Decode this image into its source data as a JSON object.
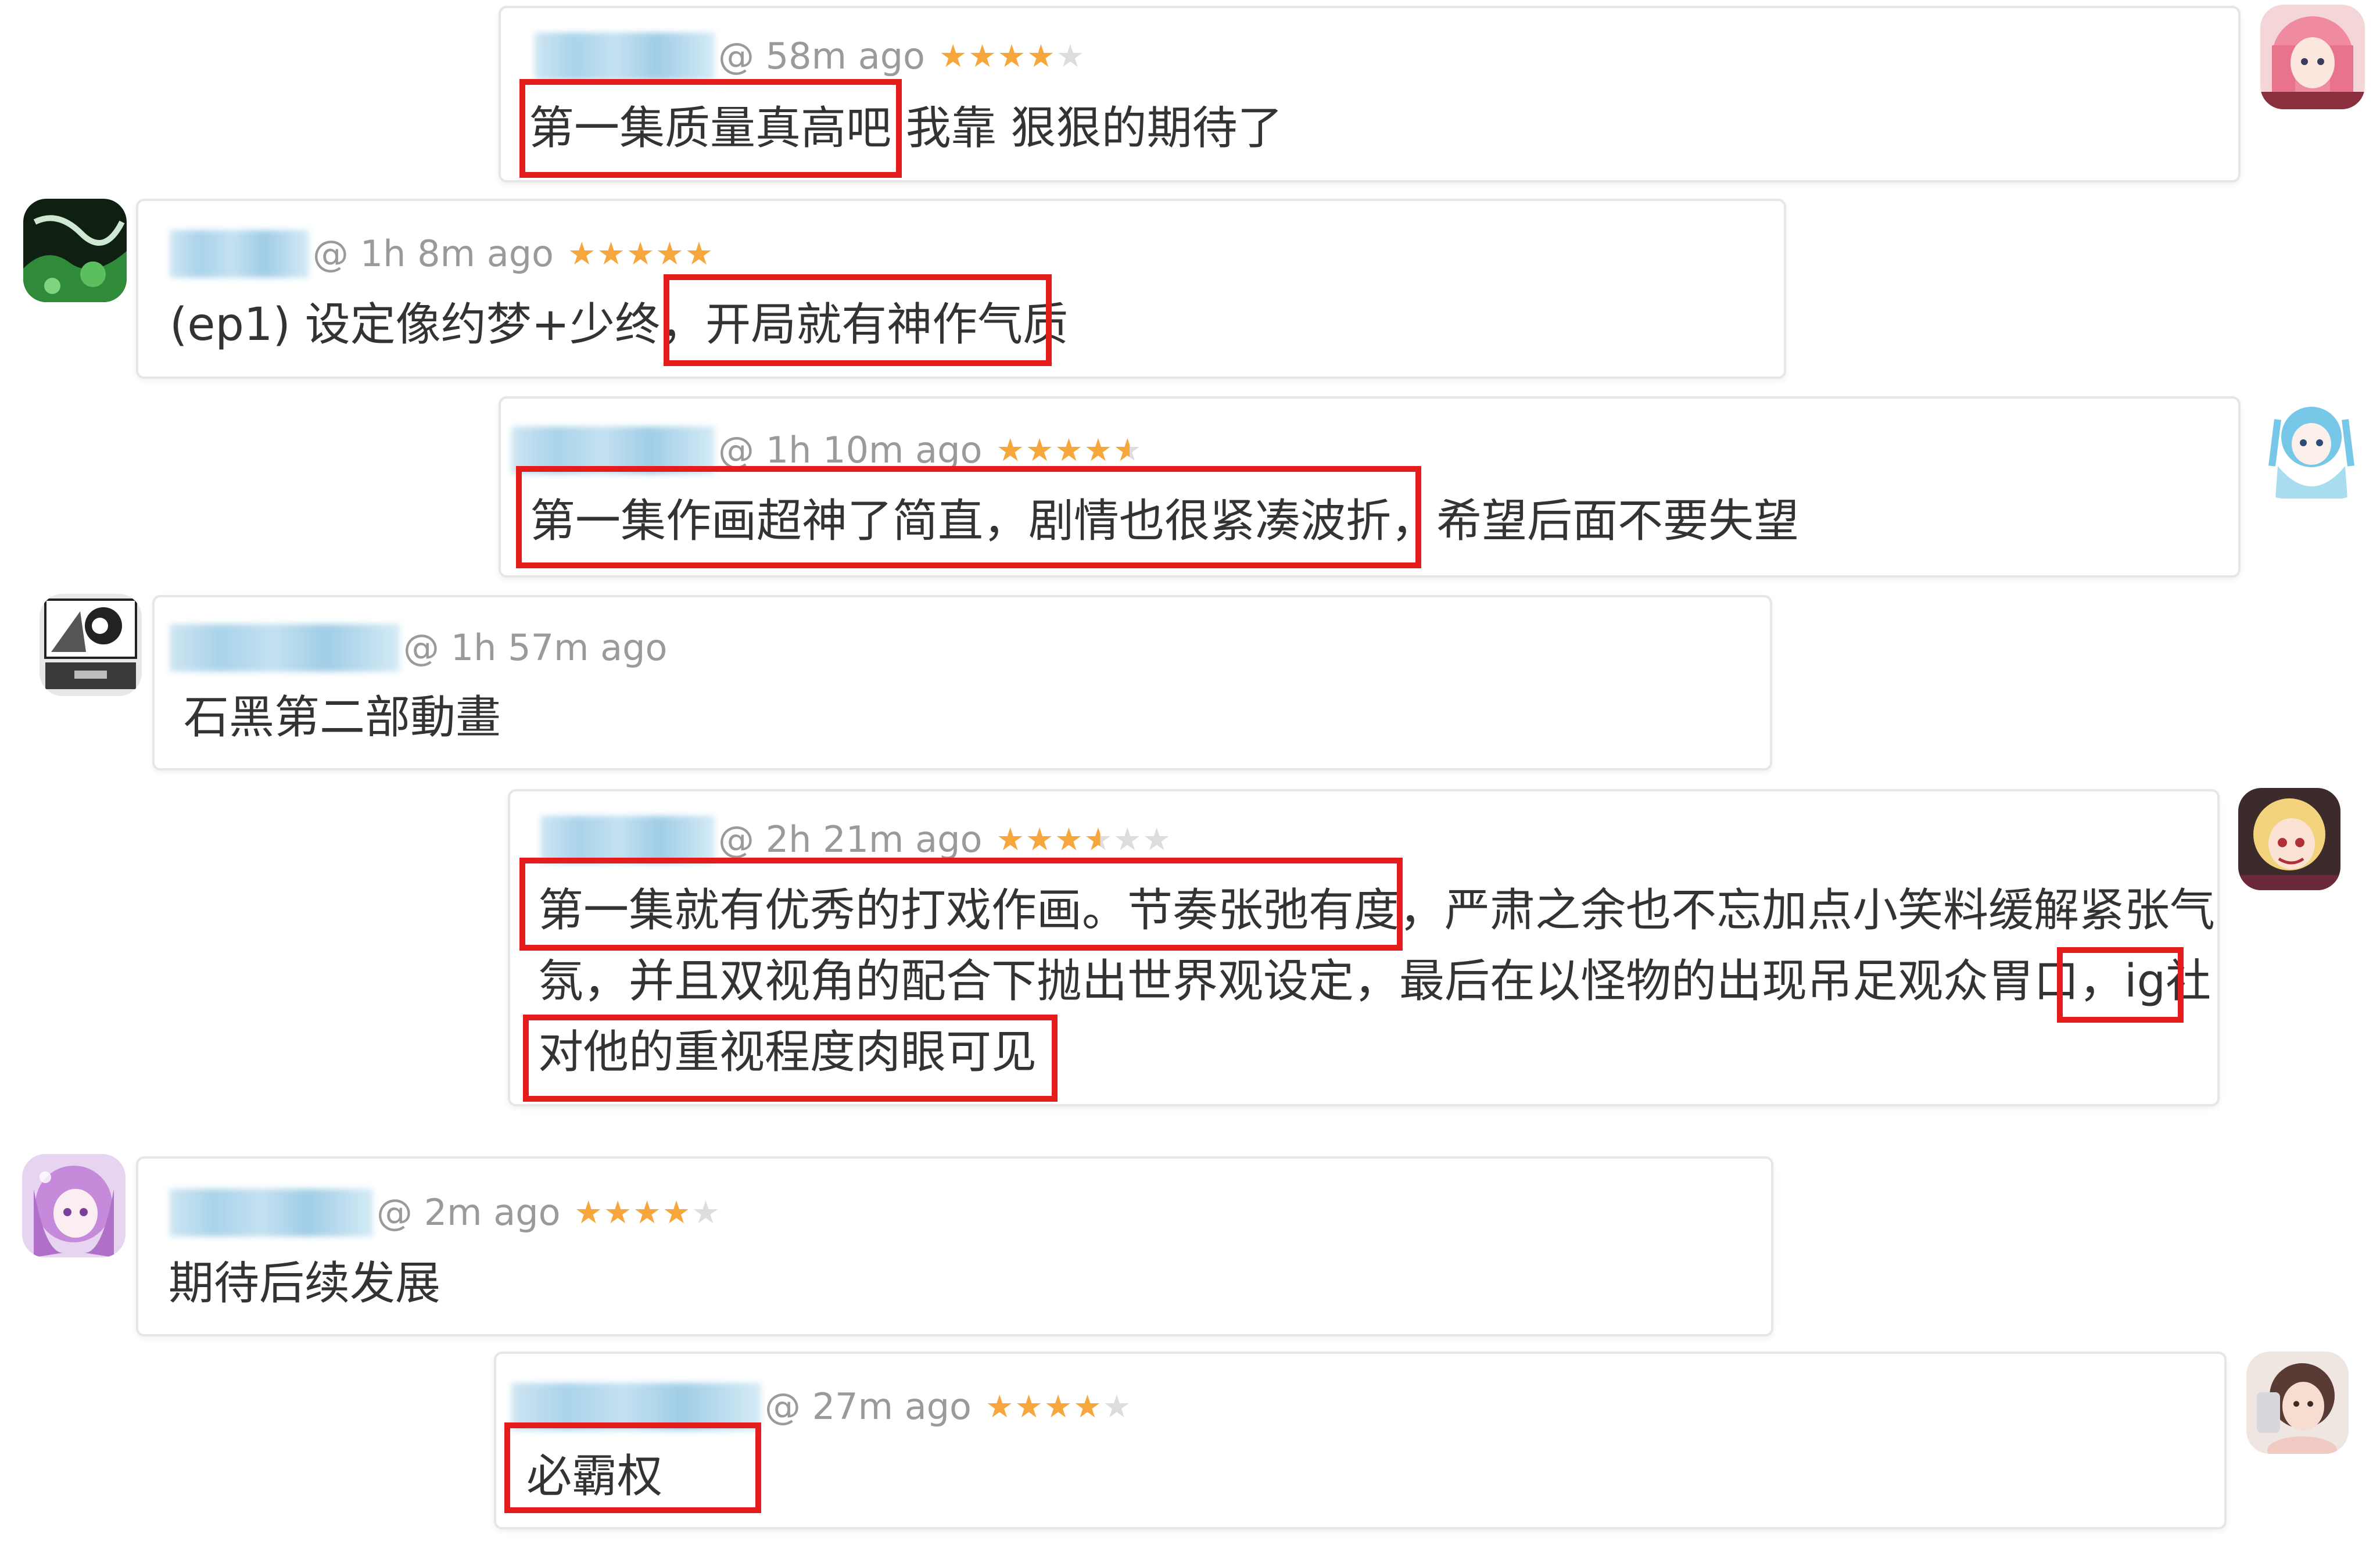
{
  "comments": [
    {
      "time": "@ 58m ago",
      "stars": [
        "on",
        "on",
        "on",
        "on",
        "off"
      ],
      "text": "第一集质量真高吧 我靠 狠狠的期待了",
      "avatar_icon": "pink-hair-girl-avatar"
    },
    {
      "time": "@ 1h 8m ago",
      "stars": [
        "on",
        "on",
        "on",
        "on",
        "on"
      ],
      "text": "(ep1) 设定像约梦+少终，开局就有神作气质",
      "avatar_icon": "dark-green-artwork-avatar"
    },
    {
      "time": "@ 1h 10m ago",
      "stars": [
        "on",
        "on",
        "on",
        "on",
        "half"
      ],
      "text": "第一集作画超神了简直，剧情也很紧凑波折，希望后面不要失望",
      "avatar_icon": "blue-hair-girl-avatar"
    },
    {
      "time": "@ 1h 57m ago",
      "stars": [],
      "text": "石黑第二部動畫",
      "avatar_icon": "manga-panel-avatar"
    },
    {
      "time": "@ 2h 21m ago",
      "stars": [
        "on",
        "on",
        "on",
        "half",
        "off",
        "off"
      ],
      "text": "第一集就有优秀的打戏作画。节奏张弛有度，严肃之余也不忘加点小笑料缓解紧张气\n氛，并且双视角的配合下抛出世界观设定，最后在以怪物的出现吊足观众胃口，ig社\n对他的重视程度肉眼可见",
      "avatar_icon": "blonde-girl-avatar"
    },
    {
      "time": "@ 2m ago",
      "stars": [
        "on",
        "on",
        "on",
        "on",
        "off"
      ],
      "text": "期待后续发展",
      "avatar_icon": "purple-hair-girl-avatar"
    },
    {
      "time": "@ 27m ago",
      "stars": [
        "on",
        "on",
        "on",
        "on",
        "off"
      ],
      "text": "必霸权",
      "avatar_icon": "selfie-girl-avatar"
    }
  ],
  "colors": {
    "star": "#f6a63a",
    "highlight": "#e51c1c",
    "meta": "#9a9a9a",
    "text": "#333333"
  }
}
